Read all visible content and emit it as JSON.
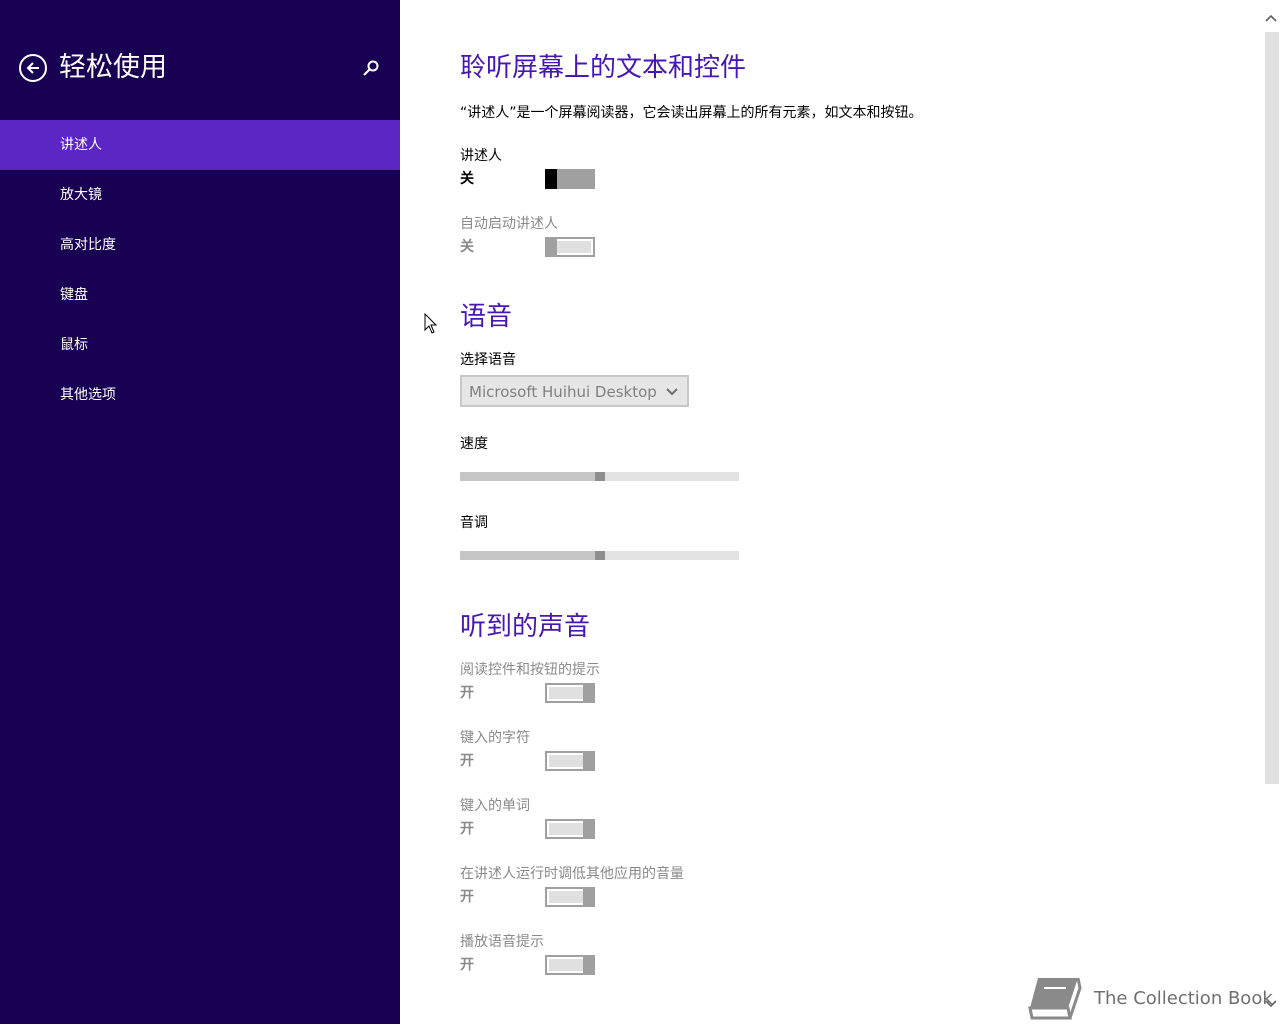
{
  "sidebar": {
    "title": "轻松使用",
    "items": [
      {
        "label": "讲述人",
        "active": true
      },
      {
        "label": "放大镜"
      },
      {
        "label": "高对比度"
      },
      {
        "label": "键盘"
      },
      {
        "label": "鼠标"
      },
      {
        "label": "其他选项"
      }
    ]
  },
  "main": {
    "section1": {
      "title": "聆听屏幕上的文本和控件",
      "description": "“讲述人”是一个屏幕阅读器，它会读出屏幕上的所有元素，如文本和按钮。",
      "narrator": {
        "label": "讲述人",
        "state": "关"
      },
      "auto_start": {
        "label": "自动启动讲述人",
        "state": "关"
      }
    },
    "section2": {
      "title": "语音",
      "voice_label": "选择语音",
      "voice_value": "Microsoft Huihui Desktop",
      "speed_label": "速度",
      "speed_value": 0.5,
      "pitch_label": "音调",
      "pitch_value": 0.5
    },
    "section3": {
      "title": "听到的声音",
      "items": [
        {
          "label": "阅读控件和按钮的提示",
          "state": "开"
        },
        {
          "label": "键入的字符",
          "state": "开"
        },
        {
          "label": "键入的单词",
          "state": "开"
        },
        {
          "label": "在讲述人运行时调低其他应用的音量",
          "state": "开"
        },
        {
          "label": "播放语音提示",
          "state": "开"
        }
      ]
    }
  },
  "watermark": {
    "text": "The Collection Book"
  },
  "colors": {
    "sidebar_bg": "#180052",
    "sidebar_active": "#5b26c4",
    "heading": "#4617b4"
  }
}
